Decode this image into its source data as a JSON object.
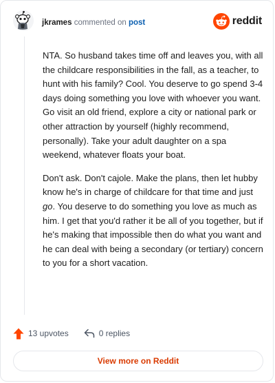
{
  "header": {
    "author": "jkrames",
    "action_text": "commented on",
    "post_link_text": "post",
    "brand_name": "reddit"
  },
  "icons": {
    "avatar": "snoo-avatar-icon",
    "brand_logo": "reddit-logo-icon",
    "upvote": "upvote-arrow-icon",
    "reply": "reply-arrow-icon"
  },
  "comment": {
    "paragraph_1": "NTA. So husband takes time off and leaves you, with all the childcare responsibilities in the fall, as a teacher, to hunt with his family? Cool. You deserve to go spend 3-4 days doing something you love with whoever you want. Go visit an old friend, explore a city or national park or other attraction by yourself (highly recommend, personally). Take your adult daughter on a spa weekend, whatever floats your boat.",
    "paragraph_2_before": "Don't ask. Don't cajole. Make the plans, then let hubby know he's in charge of childcare for that time and just ",
    "paragraph_2_emphasis": "go",
    "paragraph_2_after": ". You deserve to do something you love as much as him. I get that you'd rather it be all of you together, but if he's making that impossible then do what you want and he can deal with being a secondary (or tertiary) concern to you for a short vacation."
  },
  "footer": {
    "upvotes": "13 upvotes",
    "replies": "0 replies"
  },
  "view_more_label": "View more on Reddit",
  "colors": {
    "brand_orange": "#ff4500",
    "link_blue": "#0b5fb0",
    "button_text": "#d93a00",
    "border": "#e5e7eb"
  }
}
